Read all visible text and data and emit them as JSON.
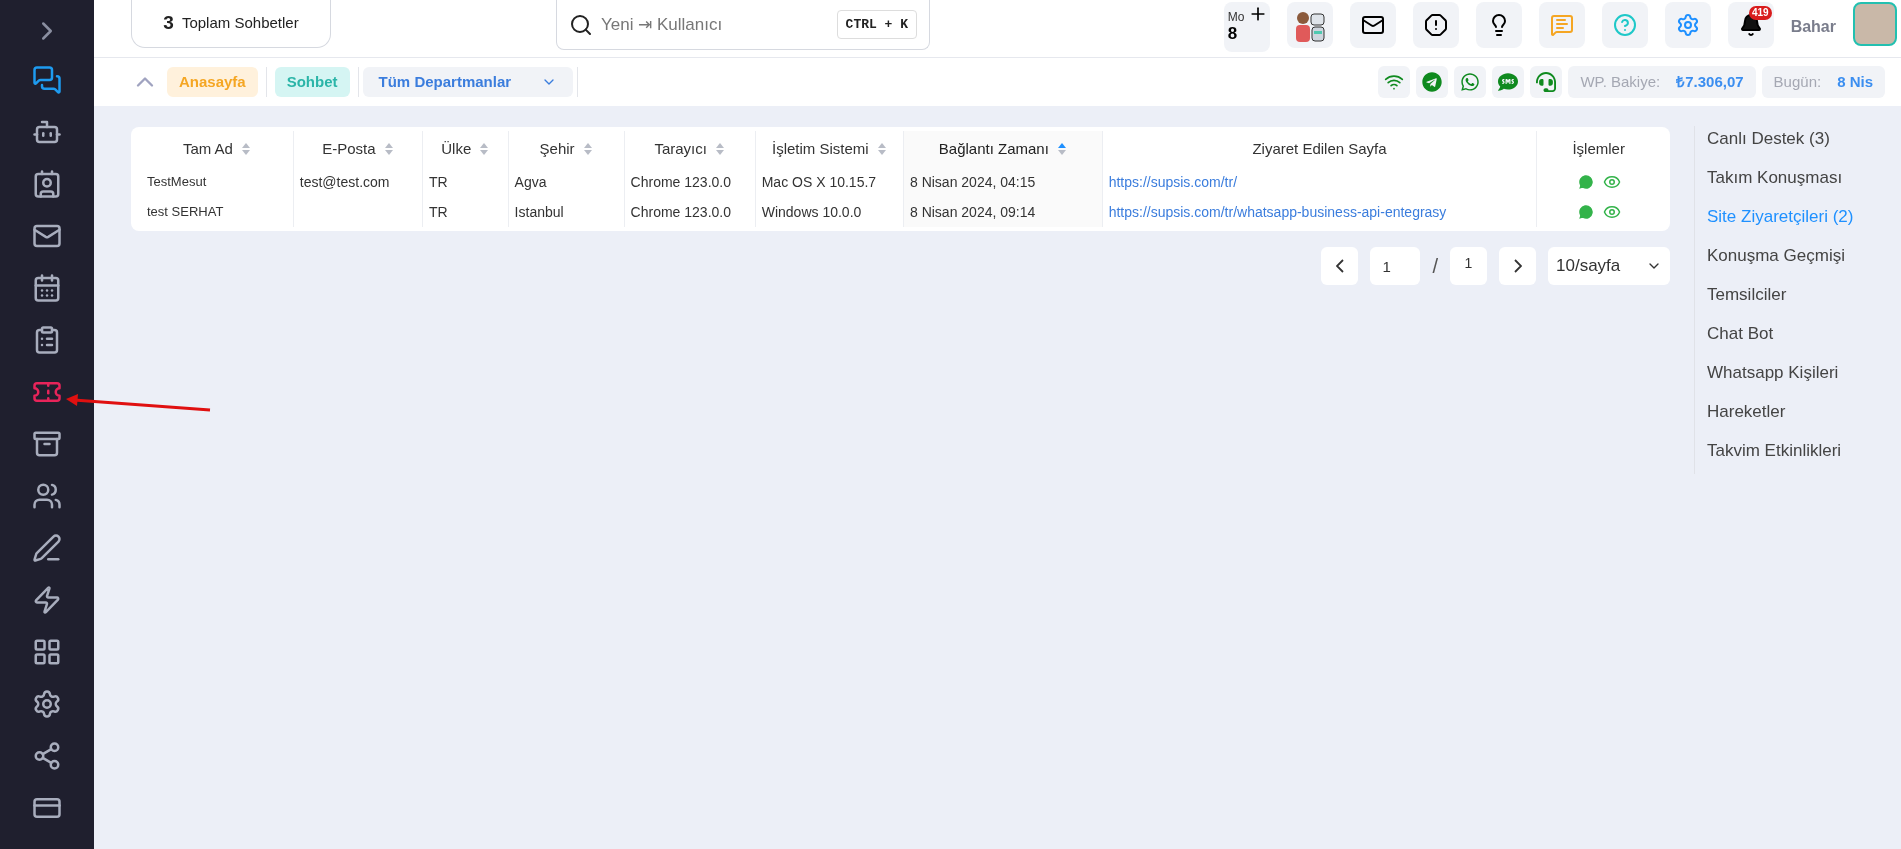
{
  "sidebar": {
    "items": [
      {
        "kind": "chat",
        "color": "#1e9bf0"
      },
      {
        "kind": "bot",
        "color": "#a8adbd"
      },
      {
        "kind": "contacts",
        "color": "#a8adbd"
      },
      {
        "kind": "mail",
        "color": "#a8adbd"
      },
      {
        "kind": "calendar",
        "color": "#a8adbd"
      },
      {
        "kind": "clipboard",
        "color": "#a8adbd"
      },
      {
        "kind": "ticket",
        "color": "#e8245a"
      },
      {
        "kind": "archive",
        "color": "#a8adbd"
      },
      {
        "kind": "users",
        "color": "#a8adbd"
      },
      {
        "kind": "edit",
        "color": "#a8adbd"
      },
      {
        "kind": "zap",
        "color": "#a8adbd"
      },
      {
        "kind": "grid",
        "color": "#a8adbd"
      },
      {
        "kind": "settings",
        "color": "#a8adbd"
      },
      {
        "kind": "share",
        "color": "#a8adbd"
      },
      {
        "kind": "card",
        "color": "#a8adbd"
      }
    ]
  },
  "header": {
    "total_count": "3",
    "total_label": "Toplam Sohbetler",
    "search": {
      "placeholder": "Yeni ⇥ Kullanıcı",
      "shortcut": "CTRL + K"
    },
    "counter": {
      "label": "Mo",
      "value": "8"
    },
    "notifications_badge": "419",
    "user_name": "Bahar"
  },
  "toolbar": {
    "breadcrumbs": [
      {
        "label": "Anasayfa",
        "kind": "home"
      },
      {
        "label": "Sohbet",
        "kind": "current"
      }
    ],
    "department_select": "Tüm Departmanlar",
    "channels": [
      {
        "kind": "wifi"
      },
      {
        "kind": "telegram"
      },
      {
        "kind": "whatsapp"
      },
      {
        "kind": "sms"
      },
      {
        "kind": "agent"
      }
    ],
    "balance_label": "WP. Bakiye:",
    "balance_value": "₺7.306,07",
    "today_label": "Bugün:",
    "today_value": "8 Nis"
  },
  "table": {
    "columns": [
      {
        "label": "Tam Ad",
        "sortable": true,
        "sorted_ascending": false
      },
      {
        "label": "E-Posta",
        "sortable": true,
        "sorted_ascending": false
      },
      {
        "label": "Ülke",
        "sortable": true,
        "sorted_ascending": false
      },
      {
        "label": "Şehir",
        "sortable": true,
        "sorted_ascending": false
      },
      {
        "label": "Tarayıcı",
        "sortable": true,
        "sorted_ascending": false
      },
      {
        "label": "İşletim Sistemi",
        "sortable": true,
        "sorted_ascending": false
      },
      {
        "label": "Bağlantı Zamanı",
        "sortable": true,
        "sorted_ascending": true
      },
      {
        "label": "Ziyaret Edilen Sayfa",
        "sortable": false,
        "sorted_ascending": false
      },
      {
        "label": "İşlemler",
        "sortable": false,
        "sorted_ascending": false
      }
    ],
    "rows": [
      {
        "cells": [
          "TestMesut",
          "test@test.com",
          "TR",
          "Agva",
          "Chrome 123.0.0",
          "Mac OS X 10.15.7",
          "8 Nisan 2024, 04:15",
          "https://supsis.com/tr/"
        ]
      },
      {
        "cells": [
          "test SERHAT",
          "",
          "TR",
          "Istanbul",
          "Chrome 123.0.0",
          "Windows 10.0.0",
          "8 Nisan 2024, 09:14",
          "https://supsis.com/tr/whatsapp-business-api-entegrasy"
        ]
      }
    ]
  },
  "pagination": {
    "page": "1",
    "separator": "/",
    "total_pages": "1",
    "page_size": "10/sayfa"
  },
  "side_nav": {
    "items": [
      {
        "label": "Canlı Destek (3)",
        "selected": false
      },
      {
        "label": "Takım Konuşması",
        "selected": false
      },
      {
        "label": "Site Ziyaretçileri (2)",
        "selected": true
      },
      {
        "label": "Konuşma Geçmişi",
        "selected": false
      },
      {
        "label": "Temsilciler",
        "selected": false
      },
      {
        "label": "Chat Bot",
        "selected": false
      },
      {
        "label": "Whatsapp Kişileri",
        "selected": false
      },
      {
        "label": "Hareketler",
        "selected": false
      },
      {
        "label": "Takvim Etkinlikleri",
        "selected": false
      }
    ]
  }
}
